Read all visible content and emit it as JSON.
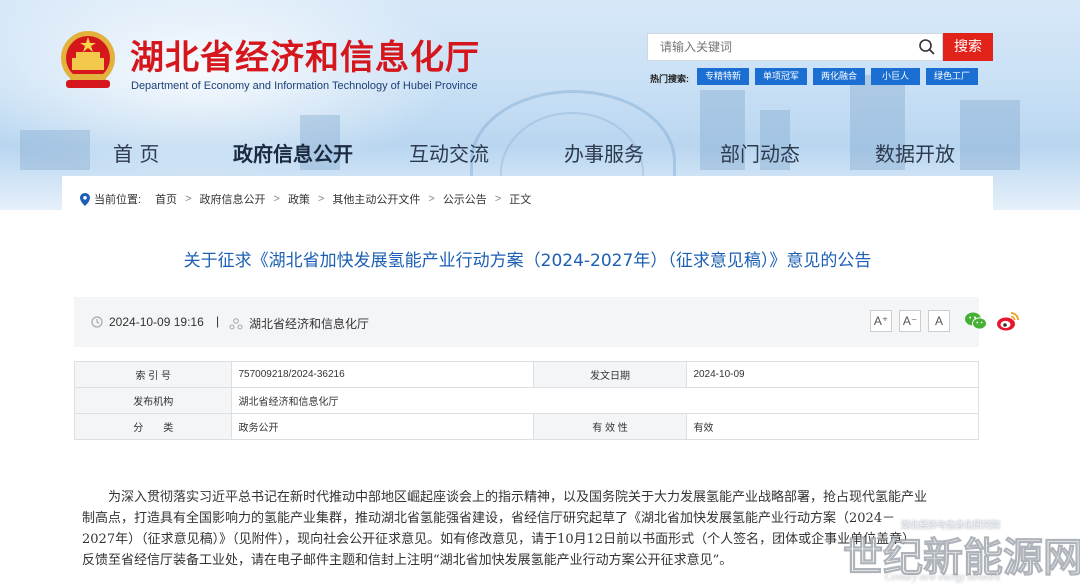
{
  "site": {
    "title_cn": "湖北省经济和信息化厅",
    "title_en": "Department of Economy and Information Technology of Hubei Province"
  },
  "search": {
    "placeholder": "请输入关键词",
    "button_label": "搜索",
    "hot_label": "热门搜索:",
    "hot_tags": [
      "专精特新",
      "单项冠军",
      "两化融合",
      "小巨人",
      "绿色工厂"
    ]
  },
  "nav": {
    "items": [
      {
        "label": "首 页",
        "active": false
      },
      {
        "label": "政府信息公开",
        "active": true
      },
      {
        "label": "互动交流",
        "active": false
      },
      {
        "label": "办事服务",
        "active": false
      },
      {
        "label": "部门动态",
        "active": false
      },
      {
        "label": "数据开放",
        "active": false
      }
    ]
  },
  "breadcrumb": {
    "prefix": "当前位置:",
    "items": [
      "首页",
      "政府信息公开",
      "政策",
      "其他主动公开文件",
      "公示公告",
      "正文"
    ],
    "separator": ">"
  },
  "article": {
    "title": "关于征求《湖北省加快发展氢能产业行动方案（2024-2027年）（征求意见稿）》意见的公告",
    "date": "2024-10-09 19:16",
    "divider": "|",
    "source": "湖北省经济和信息化厅",
    "font_buttons": [
      "A⁺",
      "A⁻",
      "A"
    ],
    "share": [
      "wechat-icon",
      "weibo-icon"
    ]
  },
  "info_table": {
    "index_label": "索 引 号",
    "index_value": "757009218/2024-36216",
    "pubdate_label": "发文日期",
    "pubdate_value": "2024-10-09",
    "org_label": "发布机构",
    "org_value": "湖北省经济和信息化厅",
    "category_label": "分　　类",
    "category_value": "政务公开",
    "validity_label": "有 效 性",
    "validity_value": "有效"
  },
  "body": {
    "paragraph": "为深入贯彻落实习近平总书记在新时代推动中部地区崛起座谈会上的指示精神，以及国务院关于大力发展氢能产业战略部署，抢占现代氢能产业制高点，打造具有全国影响力的氢能产业集群，推动湖北省氢能强省建设，省经信厅研究起草了《湖北省加快发展氢能产业行动方案（2024－2027年）（征求意见稿）》（见附件），现向社会公开征求意见。如有修改意见，请于10月12日前以书面形式（个人签名，团体或企事业单位盖章）反馈至省经信厅装备工业处，请在电子邮件主题和信封上注明“湖北省加快发展氢能产业行动方案公开征求意见”。"
  },
  "watermark": {
    "small": "湖北经济与信息化研究院",
    "big": "世纪新能源网",
    "en": "Century new energy network"
  },
  "colors": {
    "brand_red": "#d5171d",
    "search_red": "#e2231a",
    "tag_blue": "#1b6fd3",
    "title_blue": "#1c5fb4"
  }
}
